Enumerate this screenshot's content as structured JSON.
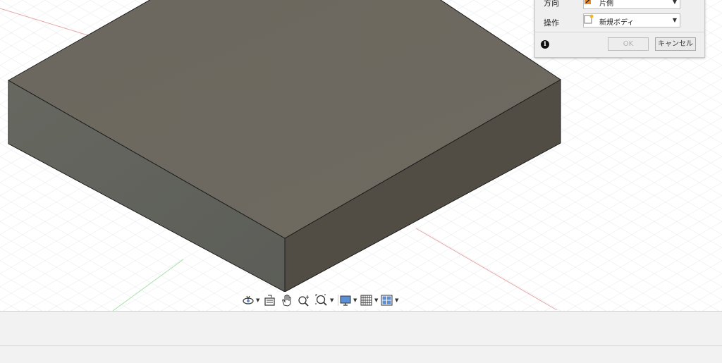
{
  "dialog": {
    "direction": {
      "label": "方向",
      "value": "片側",
      "icon": "one-side-extrude-icon"
    },
    "operation": {
      "label": "操作",
      "value": "新規ボディ",
      "icon": "new-body-icon"
    },
    "info_icon": "i",
    "ok_label": "OK",
    "cancel_label": "キャンセル"
  },
  "toolbar": {
    "items": [
      "orbit-icon",
      "look-at-icon",
      "pan-icon",
      "zoom-icon",
      "fit-icon",
      "display-settings-icon",
      "grid-icon",
      "viewports-icon"
    ]
  },
  "colors": {
    "body_top": "#6f6a60",
    "body_left": "#62635d",
    "body_right": "#4f4b44",
    "grid_line": "#e4e7ea",
    "x_axis": "#e8a2a2",
    "y_axis": "#9fe09f"
  }
}
